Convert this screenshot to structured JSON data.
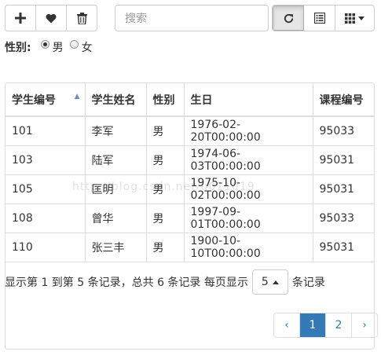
{
  "toolbar": {
    "add_icon": "plus-icon",
    "like_icon": "heart-icon",
    "delete_icon": "trash-icon",
    "search_placeholder": "搜索",
    "refresh_icon": "refresh-icon",
    "toggle_icon": "list-icon",
    "columns_icon": "grid-icon"
  },
  "filter": {
    "label": "性别:",
    "options": [
      "男",
      "女"
    ],
    "selected": "男"
  },
  "table": {
    "headers": [
      "学生编号",
      "学生姓名",
      "性别",
      "生日",
      "课程编号"
    ],
    "rows": [
      [
        "101",
        "李军",
        "男",
        "1976-02-20T00:00:00",
        "95033"
      ],
      [
        "103",
        "陆军",
        "男",
        "1974-06-03T00:00:00",
        "95031"
      ],
      [
        "105",
        "匡明",
        "男",
        "1975-10-02T00:00:00",
        "95031"
      ],
      [
        "108",
        "曾华",
        "男",
        "1997-09-01T00:00:00",
        "95033"
      ],
      [
        "110",
        "张三丰",
        "男",
        "1900-10-10T00:00:00",
        "95031"
      ]
    ]
  },
  "pagination_info": {
    "summary": "显示第 1 到第 5 条记录，总共 6 条记录 每页显示",
    "page_size": "5",
    "suffix": "条记录"
  },
  "pagination": {
    "prev": "‹",
    "pages": [
      "1",
      "2"
    ],
    "next": "›",
    "active": "1"
  },
  "watermark": "http://blog.csdn.net/u011019"
}
